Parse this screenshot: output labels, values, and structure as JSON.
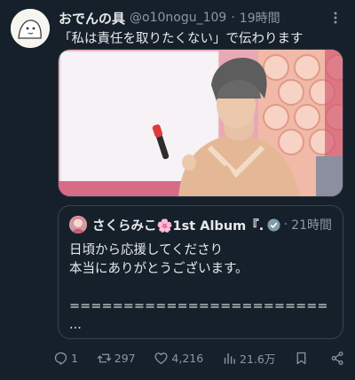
{
  "post": {
    "display_name": "おでんの具",
    "handle": "@o10nogu_109",
    "separator": "·",
    "time": "19時間",
    "text": "「私は責任を取りたくない」で伝わります"
  },
  "quote": {
    "display_name": "さくらみこ🌸1st Album『...",
    "separator": "·",
    "time": "21時間",
    "lines": [
      "日頃から応援してくださり",
      "本当にありがとうございます。",
      "",
      "========================",
      "..."
    ]
  },
  "actions": {
    "replies": "1",
    "reposts": "297",
    "likes": "4,216",
    "views": "21.6万"
  },
  "icons": {
    "more": "more-dots-icon",
    "reply": "reply-icon",
    "repost": "repost-icon",
    "like": "heart-icon",
    "views": "views-icon",
    "bookmark": "bookmark-icon",
    "share": "share-icon",
    "verified": "verified-badge-icon"
  },
  "colors": {
    "background": "#15202b",
    "text": "#e7e9ea",
    "secondary": "#8b98a5",
    "border": "#38444d"
  }
}
